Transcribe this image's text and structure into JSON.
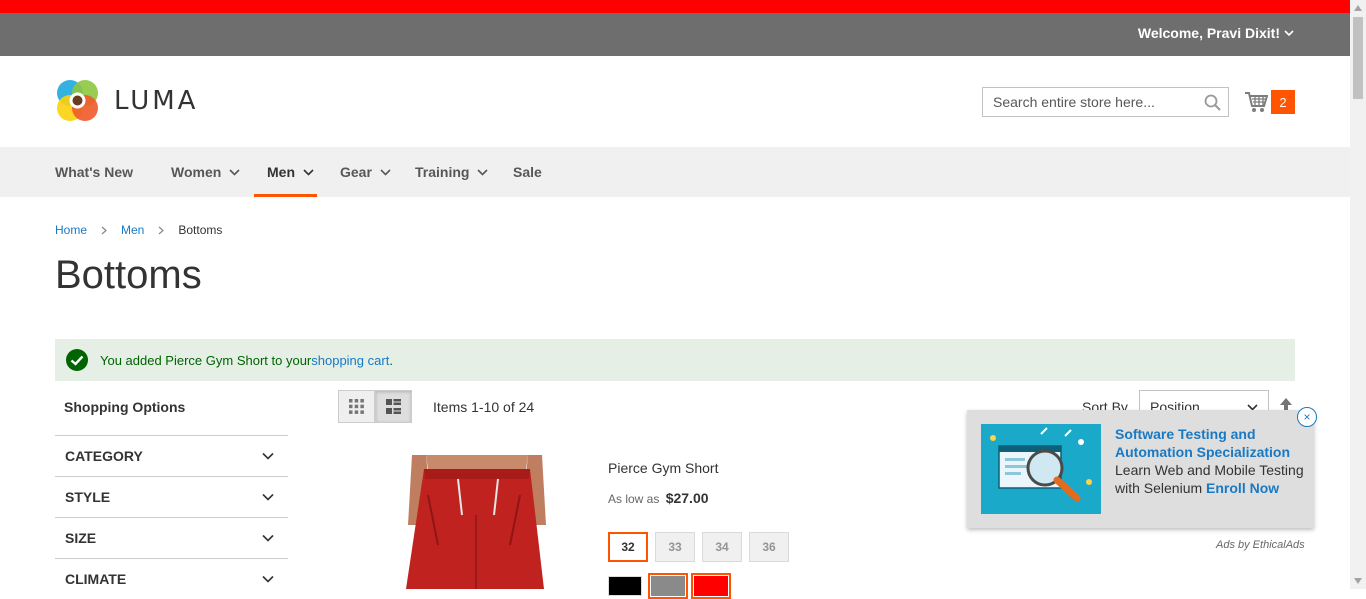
{
  "header": {
    "welcome": "Welcome, Pravi Dixit!",
    "logo_text": "LUMA",
    "search_placeholder": "Search entire store here...",
    "cart_count": "2"
  },
  "nav": {
    "items": [
      {
        "label": "What's New"
      },
      {
        "label": "Women"
      },
      {
        "label": "Men"
      },
      {
        "label": "Gear"
      },
      {
        "label": "Training"
      },
      {
        "label": "Sale"
      }
    ],
    "active": "Men"
  },
  "breadcrumb": {
    "home": "Home",
    "men": "Men",
    "current": "Bottoms"
  },
  "page_title": "Bottoms",
  "message": {
    "text": "You added Pierce Gym Short to your ",
    "link": "shopping cart",
    "end": "."
  },
  "sidebar": {
    "title": "Shopping Options",
    "filters": [
      "CATEGORY",
      "STYLE",
      "SIZE",
      "CLIMATE"
    ]
  },
  "toolbar": {
    "items_count": "Items 1-10 of 24",
    "sort_label": "Sort By",
    "sort_value": "Position"
  },
  "product": {
    "name": "Pierce Gym Short",
    "price_prefix": "As low as",
    "price": "$27.00",
    "sizes": [
      "32",
      "33",
      "34",
      "36"
    ],
    "selected_size": "32",
    "colors": [
      "#000000",
      "#8a8a8a",
      "#ff0000"
    ]
  },
  "ad": {
    "headline": "Software Testing and Automation Specialization",
    "body": "Learn Web and Mobile Testing with Selenium",
    "cta": "Enroll Now",
    "close": "×",
    "credit": "Ads by EthicalAds"
  },
  "colors": {
    "accent": "#ff5501",
    "link": "#1979c3",
    "topbar": "#6e6e6e",
    "alert_red": "#ff0000"
  }
}
